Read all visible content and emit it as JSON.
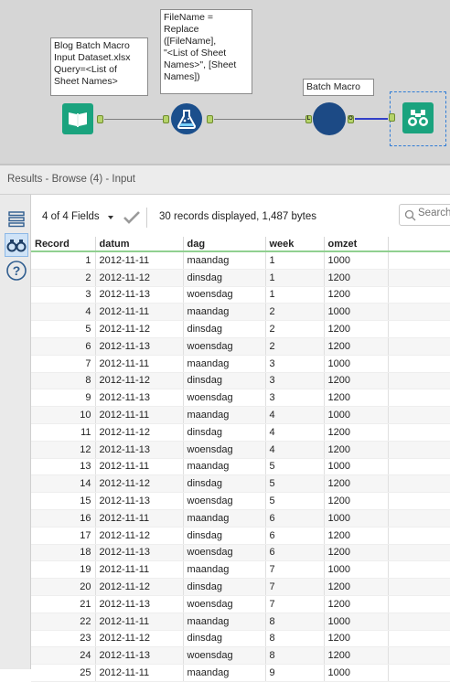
{
  "canvas": {
    "notes": {
      "input": "Blog Batch Macro\nInput Dataset.xlsx\nQuery=<List of\nSheet Names>",
      "formula": "FileName =\nReplace\n([FileName],\n\"<List of Sheet\nNames>\", [Sheet\nNames])",
      "macro": "Batch Macro"
    },
    "anchors": {
      "macro_in": "L",
      "macro_out": "O"
    },
    "colors": {
      "tool_green": "#1aa37e",
      "tool_blue": "#1b4f8c",
      "anchor_green": "#b5d36a",
      "wire_blue": "#3340c8"
    }
  },
  "results": {
    "title": "Results - Browse (4) - Input",
    "fields_label": "4 of 4 Fields",
    "records_info": "30 records displayed, 1,487 bytes",
    "search_placeholder": "Search"
  },
  "sidebar": {
    "icons": [
      "list-view-icon",
      "binoculars-icon",
      "help-icon"
    ]
  },
  "grid": {
    "columns": [
      "Record",
      "datum",
      "dag",
      "week",
      "omzet"
    ],
    "rows": [
      [
        "1",
        "2012-11-11",
        "maandag",
        "1",
        "1000"
      ],
      [
        "2",
        "2012-11-12",
        "dinsdag",
        "1",
        "1200"
      ],
      [
        "3",
        "2012-11-13",
        "woensdag",
        "1",
        "1200"
      ],
      [
        "4",
        "2012-11-11",
        "maandag",
        "2",
        "1000"
      ],
      [
        "5",
        "2012-11-12",
        "dinsdag",
        "2",
        "1200"
      ],
      [
        "6",
        "2012-11-13",
        "woensdag",
        "2",
        "1200"
      ],
      [
        "7",
        "2012-11-11",
        "maandag",
        "3",
        "1000"
      ],
      [
        "8",
        "2012-11-12",
        "dinsdag",
        "3",
        "1200"
      ],
      [
        "9",
        "2012-11-13",
        "woensdag",
        "3",
        "1200"
      ],
      [
        "10",
        "2012-11-11",
        "maandag",
        "4",
        "1000"
      ],
      [
        "11",
        "2012-11-12",
        "dinsdag",
        "4",
        "1200"
      ],
      [
        "12",
        "2012-11-13",
        "woensdag",
        "4",
        "1200"
      ],
      [
        "13",
        "2012-11-11",
        "maandag",
        "5",
        "1000"
      ],
      [
        "14",
        "2012-11-12",
        "dinsdag",
        "5",
        "1200"
      ],
      [
        "15",
        "2012-11-13",
        "woensdag",
        "5",
        "1200"
      ],
      [
        "16",
        "2012-11-11",
        "maandag",
        "6",
        "1000"
      ],
      [
        "17",
        "2012-11-12",
        "dinsdag",
        "6",
        "1200"
      ],
      [
        "18",
        "2012-11-13",
        "woensdag",
        "6",
        "1200"
      ],
      [
        "19",
        "2012-11-11",
        "maandag",
        "7",
        "1000"
      ],
      [
        "20",
        "2012-11-12",
        "dinsdag",
        "7",
        "1200"
      ],
      [
        "21",
        "2012-11-13",
        "woensdag",
        "7",
        "1200"
      ],
      [
        "22",
        "2012-11-11",
        "maandag",
        "8",
        "1000"
      ],
      [
        "23",
        "2012-11-12",
        "dinsdag",
        "8",
        "1200"
      ],
      [
        "24",
        "2012-11-13",
        "woensdag",
        "8",
        "1200"
      ],
      [
        "25",
        "2012-11-11",
        "maandag",
        "9",
        "1000"
      ]
    ]
  }
}
